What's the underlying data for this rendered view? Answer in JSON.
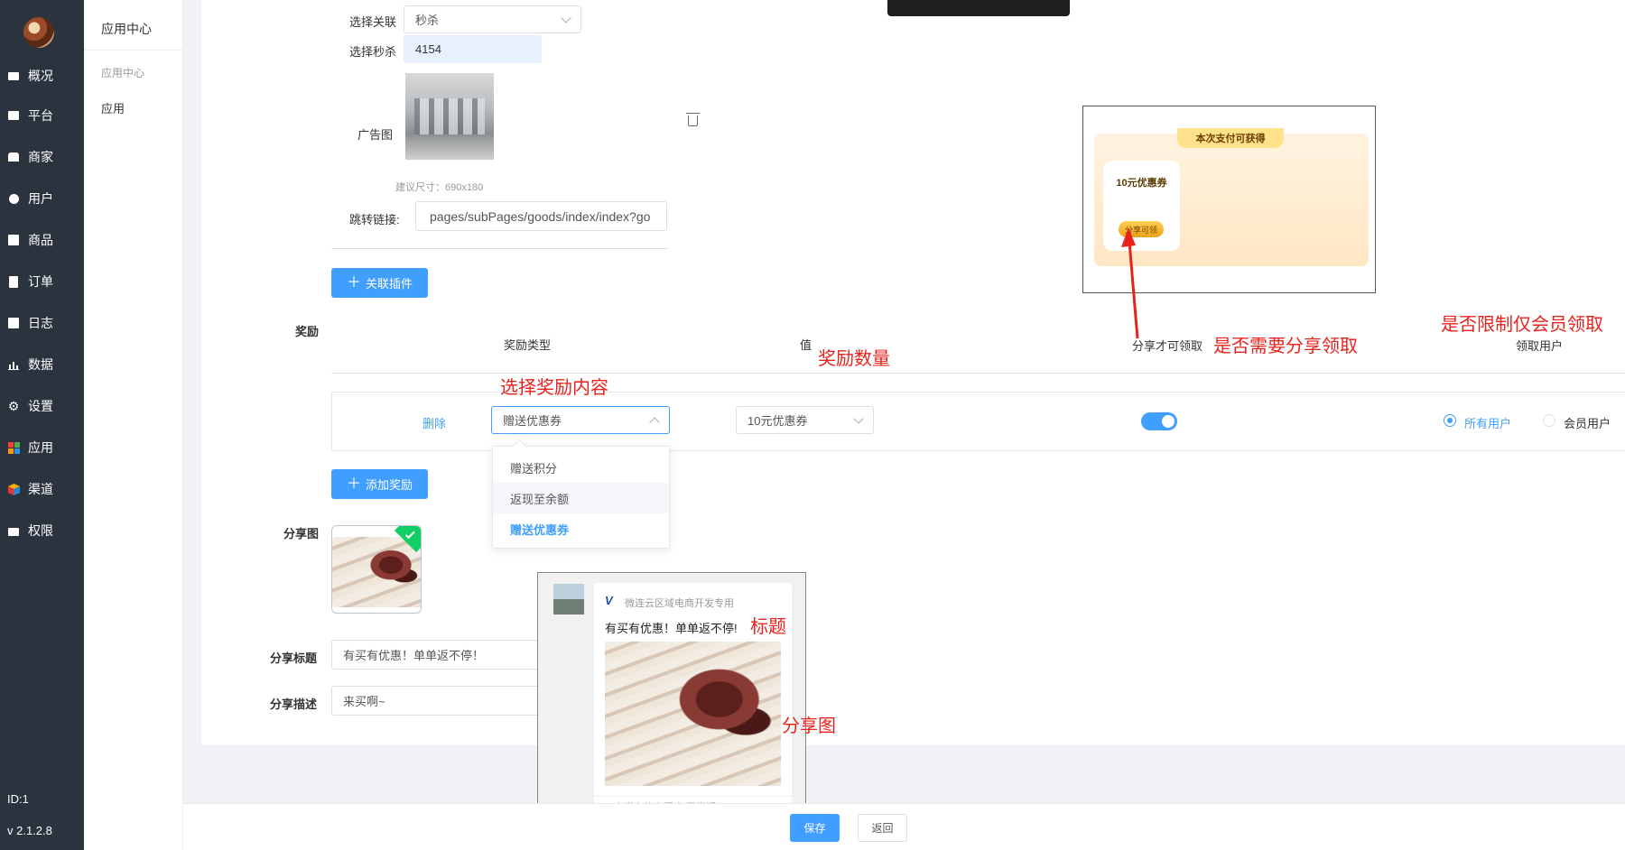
{
  "sidebar": {
    "items": [
      {
        "label": "概况",
        "icon": "dashboard-icon"
      },
      {
        "label": "平台",
        "icon": "monitor-icon"
      },
      {
        "label": "商家",
        "icon": "store-icon"
      },
      {
        "label": "用户",
        "icon": "user-icon"
      },
      {
        "label": "商品",
        "icon": "goods-icon"
      },
      {
        "label": "订单",
        "icon": "order-icon"
      },
      {
        "label": "日志",
        "icon": "log-icon"
      },
      {
        "label": "数据",
        "icon": "chart-icon"
      },
      {
        "label": "设置",
        "icon": "gear-icon"
      },
      {
        "label": "应用",
        "icon": "apps-grid-icon"
      },
      {
        "label": "渠道",
        "icon": "cube-icon"
      },
      {
        "label": "权限",
        "icon": "lock-icon"
      }
    ],
    "id_text": "ID:1",
    "version": "v 2.1.2.8"
  },
  "submenu": {
    "header": "应用中心",
    "group": "应用中心",
    "item": "应用"
  },
  "form": {
    "relate_label": "选择关联",
    "relate_value": "秒杀",
    "seckill_label": "选择秒杀",
    "seckill_value": "4154",
    "ad_label": "广告图",
    "ad_hint": "建议尺寸：690x180",
    "link_label": "跳转链接:",
    "link_value": "pages/subPages/goods/index/index?go",
    "add_plugin": "关联插件",
    "reward_label": "奖励",
    "col_type": "奖励类型",
    "col_value": "值",
    "col_share": "分享才可领取",
    "col_user": "领取用户",
    "row_delete": "删除",
    "row_type": "赠送优惠券",
    "row_value": "10元优惠券",
    "radio_all": "所有用户",
    "radio_member": "会员用户",
    "dropdown": [
      "赠送积分",
      "返现至余额",
      "赠送优惠券"
    ],
    "add_reward": "添加奖励",
    "share_img_label": "分享图",
    "share_title_label": "分享标题",
    "share_title_value": "有买有优惠！单单返不停！",
    "share_desc_label": "分享描述",
    "share_desc_value": "来买啊~"
  },
  "annotations": {
    "share_need": "是否需要分享领取",
    "member_only": "是否限制仅会员领取",
    "amount": "奖励数量",
    "choose": "选择奖励内容",
    "title": "标题",
    "share_img": "分享图"
  },
  "reward_preview": {
    "banner": "本次支付可获得",
    "coupon": "10元优惠券",
    "button": "分享可领"
  },
  "share_preview": {
    "app_name": "微连云区域电商开发专用",
    "title": "有买有优惠！单单返不停!",
    "footer": "未发布的小程序 开发版"
  },
  "footer": {
    "save": "保存",
    "back": "返回"
  },
  "colors": {
    "sidebar_bg": "#2b333e",
    "primary": "#409eff",
    "annotation": "#e8231e"
  }
}
